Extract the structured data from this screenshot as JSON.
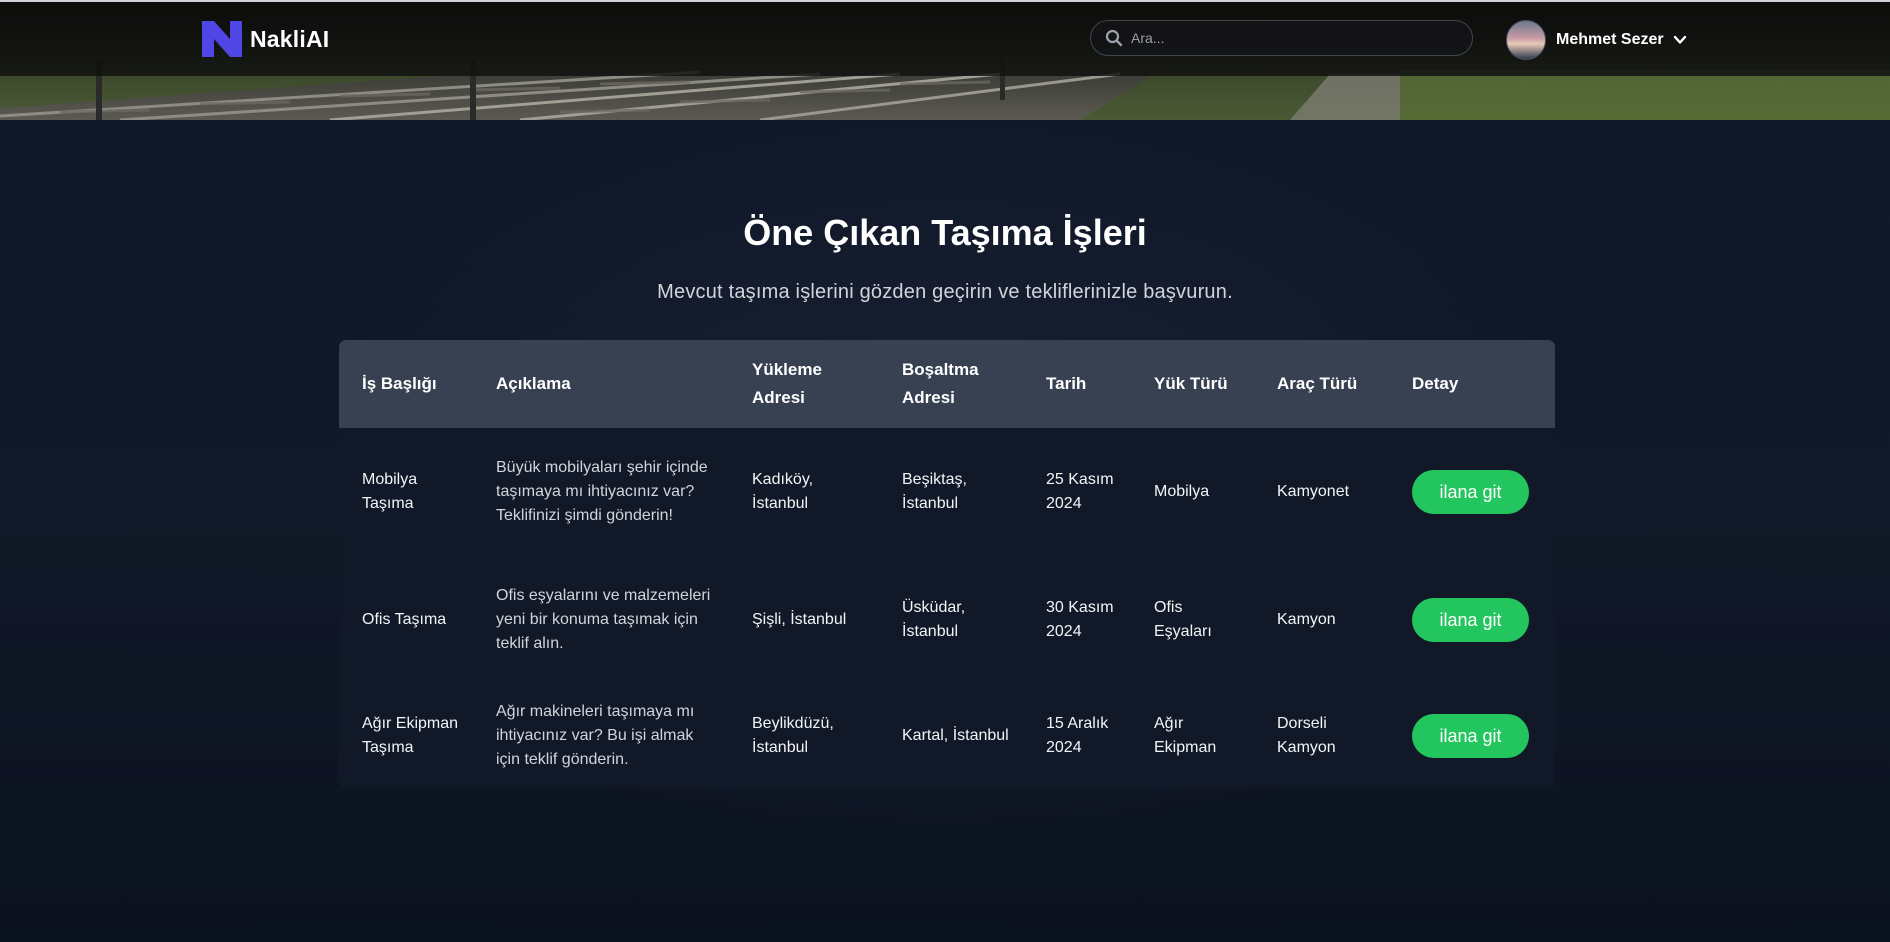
{
  "brand": {
    "name": "NakliAI",
    "accent_color": "#4f46e5"
  },
  "search": {
    "placeholder": "Ara..."
  },
  "user": {
    "name": "Mehmet Sezer"
  },
  "section": {
    "title": "Öne Çıkan Taşıma İşleri",
    "subtitle": "Mevcut taşıma işlerini gözden geçirin ve tekliflerinizle başvurun."
  },
  "table": {
    "headers": {
      "title": "İş Başlığı",
      "description": "Açıklama",
      "pickup": "Yükleme Adresi",
      "dropoff": "Boşaltma Adresi",
      "date": "Tarih",
      "cargo": "Yük Türü",
      "vehicle": "Araç Türü",
      "detail": "Detay"
    },
    "rows": [
      {
        "title": "Mobilya Taşıma",
        "description": "Büyük mobilyaları şehir içinde taşımaya mı ihtiyacınız var? Teklifinizi şimdi gönderin!",
        "pickup": "Kadıköy, İstanbul",
        "dropoff": "Beşiktaş, İstanbul",
        "date": "25 Kasım 2024",
        "cargo": "Mobilya",
        "vehicle": "Kamyonet",
        "button": "ilana git"
      },
      {
        "title": "Ofis Taşıma",
        "description": "Ofis eşyalarını ve malzemeleri yeni bir konuma taşımak için teklif alın.",
        "pickup": "Şişli, İstanbul",
        "dropoff": "Üsküdar, İstanbul",
        "date": "30 Kasım 2024",
        "cargo": "Ofis Eşyaları",
        "vehicle": "Kamyon",
        "button": "ilana git"
      },
      {
        "title": "Ağır Ekipman Taşıma",
        "description": "Ağır makineleri taşımaya mı ihtiyacınız var? Bu işi almak için teklif gönderin.",
        "pickup": "Beylikdüzü, İstanbul",
        "dropoff": "Kartal, İstanbul",
        "date": "15 Aralık 2024",
        "cargo": "Ağır Ekipman",
        "vehicle": "Dorseli Kamyon",
        "button": "ilana git"
      }
    ]
  },
  "colors": {
    "button_green": "#22c55e",
    "table_header_bg": "#374151",
    "page_bg": "#111827"
  }
}
